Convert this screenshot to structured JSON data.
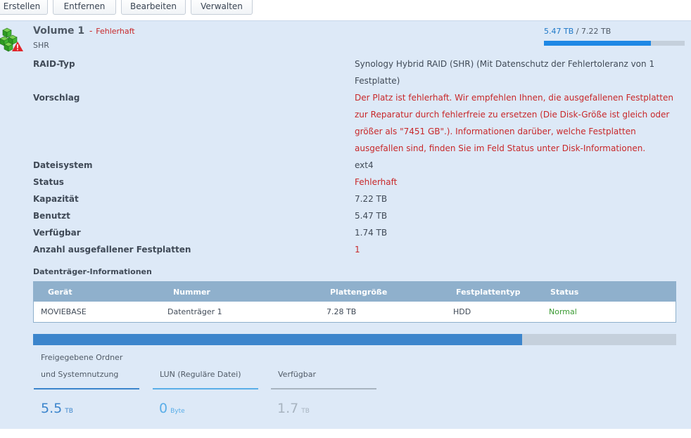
{
  "toolbar": {
    "buttons": [
      "Erstellen",
      "Entfernen",
      "Bearbeiten",
      "Verwalten"
    ]
  },
  "volume": {
    "icon": "volume-cubes-warning-icon",
    "title": "Volume 1",
    "separator": "-",
    "state": "Fehlerhaft",
    "type": "SHR",
    "usage": {
      "used": "5.47 TB",
      "slash": "/",
      "total": "7.22 TB",
      "fraction": 0.758
    }
  },
  "details": {
    "raid_label": "RAID-Typ",
    "raid_value": "Synology Hybrid RAID (SHR) (Mit Datenschutz der Fehlertoleranz von 1 Festplatte)",
    "suggestion_label": "Vorschlag",
    "suggestion_value": "Der Platz ist fehlerhaft. Wir empfehlen Ihnen, die ausgefallenen Festplatten zur Reparatur durch fehlerfreie zu ersetzen (Die Disk-Größe ist gleich oder größer als \"7451 GB\".). Informationen darüber, welche Festplatten ausgefallen sind, finden Sie im Feld Status unter Disk-Informationen.",
    "fs_label": "Dateisystem",
    "fs_value": "ext4",
    "status_label": "Status",
    "status_value": "Fehlerhaft",
    "capacity_label": "Kapazität",
    "capacity_value": "7.22 TB",
    "used_label": "Benutzt",
    "used_value": "5.47 TB",
    "avail_label": "Verfügbar",
    "avail_value": "1.74 TB",
    "failed_label": "Anzahl ausgefallener Festplatten",
    "failed_value": "1"
  },
  "disks": {
    "title": "Datenträger-Informationen",
    "headers": [
      "Gerät",
      "Nummer",
      "Plattengröße",
      "Festplattentyp",
      "Status"
    ],
    "rows": [
      [
        "MOVIEBASE",
        "Datenträger 1",
        "7.28 TB",
        "HDD",
        "Normal"
      ]
    ]
  },
  "breakdown": {
    "used_fraction": 0.76,
    "items": [
      {
        "label1": "Freigegebene Ordner",
        "label2": "und Systemnutzung",
        "value": "5.5",
        "unit": "TB",
        "color": "#3c85cc"
      },
      {
        "label1": "",
        "label2": "LUN (Reguläre Datei)",
        "value": "0",
        "unit": "Byte",
        "color": "#5aaee8"
      },
      {
        "label1": "",
        "label2": "Verfügbar",
        "value": "1.7",
        "unit": "TB",
        "color": "#a8b4c0"
      }
    ]
  }
}
